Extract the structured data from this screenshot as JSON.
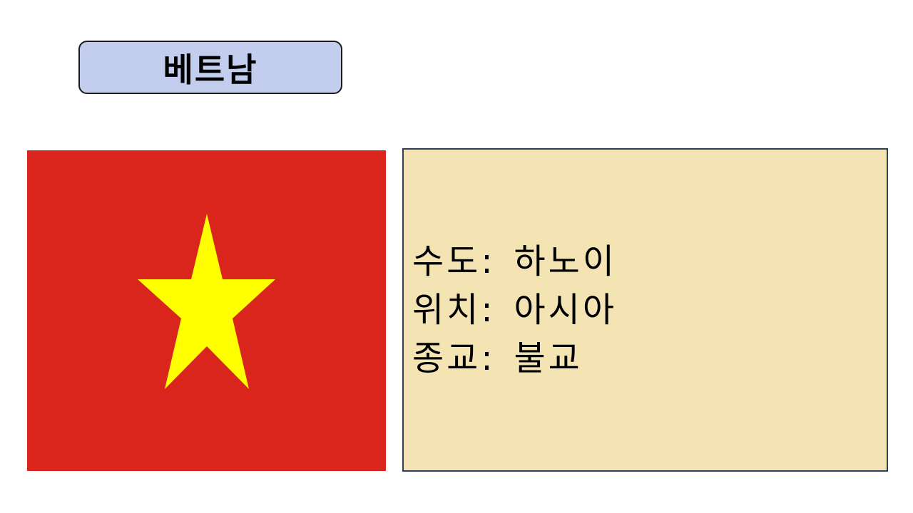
{
  "title": {
    "text": "베트남",
    "background": "#c3cdee"
  },
  "flag": {
    "icon": "vietnam-flag-icon",
    "background_color": "#da251d",
    "star_color": "#ffff00"
  },
  "info": {
    "background": "#f5e4b3",
    "items": [
      {
        "label": "수도",
        "value": "하노이"
      },
      {
        "label": "위치",
        "value": "아시아"
      },
      {
        "label": "종교",
        "value": "불교"
      }
    ]
  }
}
